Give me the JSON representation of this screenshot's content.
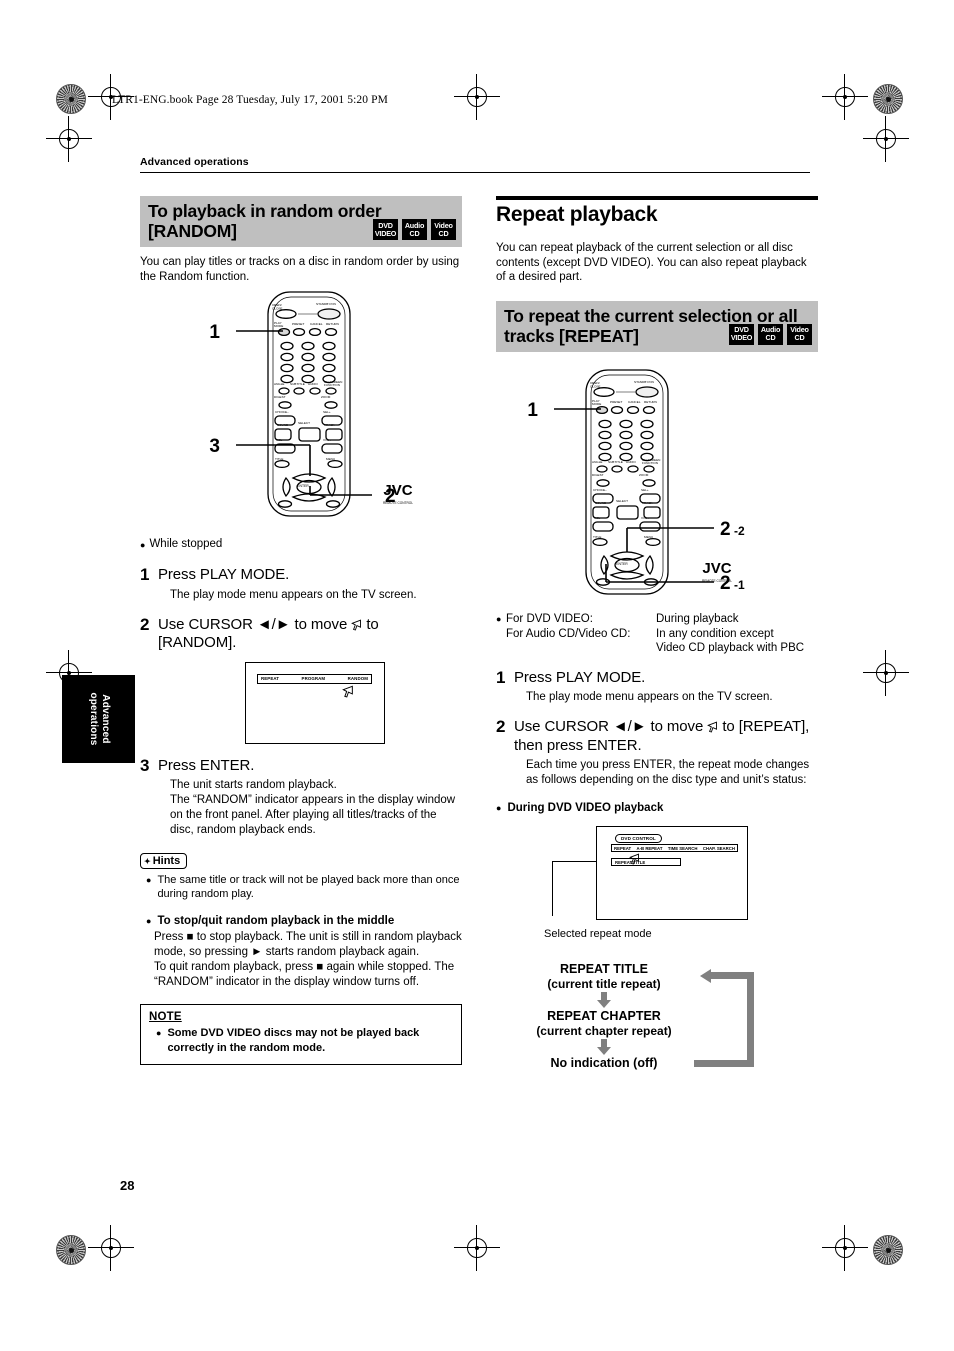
{
  "page": {
    "file_stamp": "LTR1-ENG.book  Page 28  Tuesday, July 17, 2001  5:20 PM",
    "breadcrumb": "Advanced operations",
    "side_tab": "Advanced operations",
    "page_number": "28"
  },
  "badges": [
    {
      "line1": "DVD",
      "line2": "VIDEO"
    },
    {
      "line1": "Audio",
      "line2": "CD"
    },
    {
      "line1": "Video",
      "line2": "CD"
    }
  ],
  "left_column": {
    "heading_line1": "To playback in random order",
    "heading_line2": "[RANDOM]",
    "intro": "You can play titles or tracks on a disc in random order by using the Random function.",
    "remote_callouts": [
      "1",
      "3",
      "2"
    ],
    "remote_brand": "JVC",
    "remote_sub_brand": "REMOTE CONTROL",
    "condition": "While stopped",
    "steps": [
      {
        "num": "1",
        "text": "Press PLAY MODE.",
        "detail": "The play mode menu appears on the TV screen."
      },
      {
        "num": "2",
        "text_before": "Use CURSOR ◄/► to move",
        "text_after": "to",
        "text_line2": "[RANDOM].",
        "detail": ""
      },
      {
        "num": "3",
        "text": "Press ENTER.",
        "detail": "The unit starts random playback.\nThe “RANDOM” indicator appears in the display window on the front panel. After playing all titles/tracks of the disc, random playback ends."
      }
    ],
    "tv_screen": {
      "items": [
        "REPEAT",
        "PROGRAM",
        "RANDOM"
      ],
      "cursor_on": "RANDOM"
    },
    "hints_label": "Hints",
    "hints": [
      "The same title or track will not be played back more than once during random play."
    ],
    "subsection_title": "To stop/quit random playback in the middle",
    "subsection_body": "Press ■ to stop playback. The unit is still in random playback mode, so pressing ► starts random playback again.\nTo quit random playback, press ■ again while stopped. The “RANDOM” indicator in the display window turns off.",
    "note": {
      "heading": "NOTE",
      "items": [
        "Some DVD VIDEO discs may not be played back correctly in the random mode."
      ]
    }
  },
  "right_column": {
    "main_title": "Repeat playback",
    "intro": "You can repeat playback of the current selection or all disc contents (except DVD VIDEO). You can also repeat playback of a desired part.",
    "heading_line1": "To repeat the current selection or all",
    "heading_line2": "tracks [REPEAT]",
    "remote_callouts": [
      "1",
      "2-2",
      "2-1"
    ],
    "remote_brand": "JVC",
    "remote_sub_brand": "REMOTE CONTROL",
    "condition_rows": [
      {
        "label": "For DVD VIDEO:",
        "value": "During playback"
      },
      {
        "label": "For Audio CD/Video CD:",
        "value": "In any condition except"
      },
      {
        "label": "",
        "value": "Video CD playback with PBC"
      }
    ],
    "steps": [
      {
        "num": "1",
        "text": "Press PLAY MODE.",
        "detail": "The play mode menu appears on the TV screen."
      },
      {
        "num": "2",
        "text_before": "Use CURSOR ◄/► to move",
        "text_after": "to [REPEAT],",
        "text_line2": "then press ENTER.",
        "detail": "Each time you press ENTER, the repeat mode changes as follows depending on the disc type and unit’s status:"
      }
    ],
    "subsection_title": "During DVD VIDEO playback",
    "osd": {
      "title": "DVD CONTROL",
      "menu_items": [
        "REPEAT",
        "A-B REPEAT",
        "TIME SEARCH",
        "CHAP. SEARCH"
      ],
      "selected_row": "REPEAT  TITLE",
      "caption": "Selected repeat mode"
    },
    "cycle": {
      "steps": [
        {
          "main": "REPEAT TITLE",
          "sub": "(current title repeat)"
        },
        {
          "main": "REPEAT CHAPTER",
          "sub": "(current chapter repeat)"
        },
        {
          "main": "No indication (off)",
          "sub": ""
        }
      ]
    }
  }
}
